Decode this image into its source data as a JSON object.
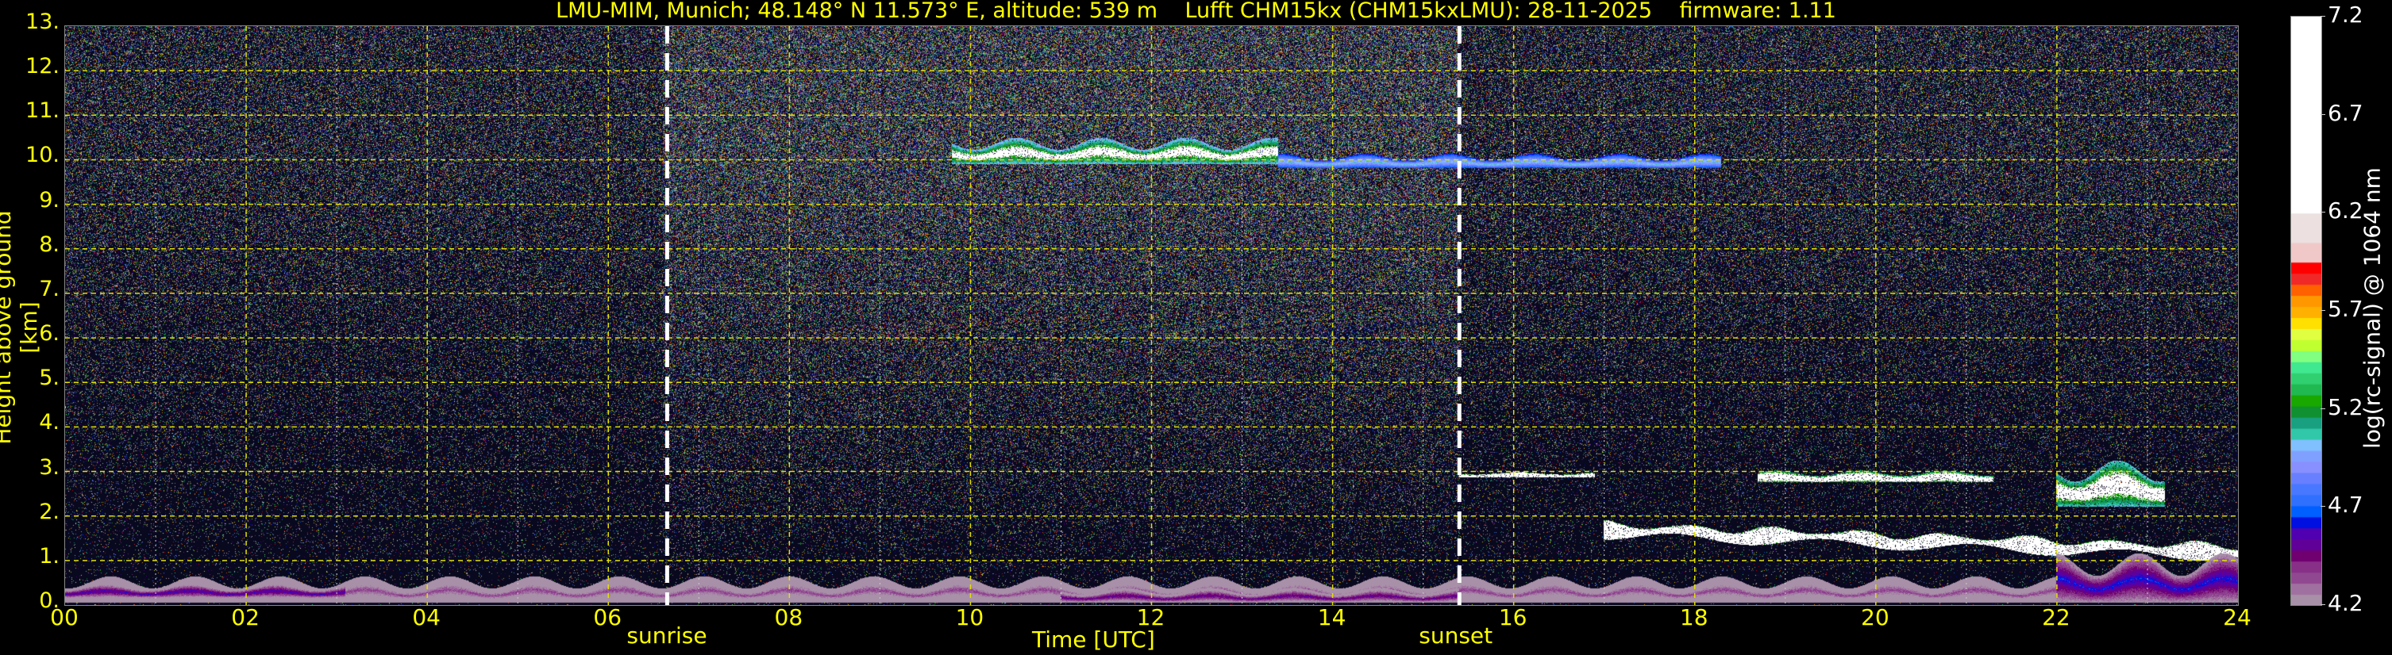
{
  "chart_data": {
    "type": "heatmap",
    "title": "LMU-MIM, Munich; 48.148° N 11.573° E, altitude: 539 m    Lufft CHM15kx (CHM15kxLMU): 28-11-2025    firmware: 1.11",
    "xlabel": "Time [UTC]",
    "ylabel": "Height above ground [km]",
    "xlim": [
      0,
      24
    ],
    "ylim": [
      0,
      13
    ],
    "x_ticks": [
      "00",
      "02",
      "04",
      "06",
      "08",
      "10",
      "12",
      "14",
      "16",
      "18",
      "20",
      "22",
      "24"
    ],
    "y_ticks": [
      "0.",
      "1.",
      "2.",
      "3.",
      "4.",
      "5.",
      "6.",
      "7.",
      "8.",
      "9.",
      "10.",
      "11.",
      "12.",
      "13."
    ],
    "grid": true,
    "events": [
      {
        "label": "sunrise",
        "hour": 6.65
      },
      {
        "label": "sunset",
        "hour": 15.4
      }
    ],
    "colorbar": {
      "label": "log(rc-signal) @ 1064 nm",
      "range": [
        4.2,
        7.2
      ],
      "ticks": [
        "4.2",
        "4.7",
        "5.2",
        "5.7",
        "6.2",
        "6.7",
        "7.2"
      ],
      "colors": [
        "#a890a8",
        "#a070a0",
        "#904890",
        "#883088",
        "#700070",
        "#600098",
        "#5000b0",
        "#0010e0",
        "#0060ff",
        "#3070ff",
        "#4878ff",
        "#6880ff",
        "#8890ff",
        "#80a0ff",
        "#80c0ff",
        "#30c8a8",
        "#18a080",
        "#109030",
        "#18a800",
        "#20b850",
        "#30d070",
        "#40e890",
        "#80ff80",
        "#c0ff30",
        "#e0ff40",
        "#ffe000",
        "#ffb000",
        "#ff9800",
        "#ff6000",
        "#f02828",
        "#ff0000",
        "#f0c8c8",
        "#ece0e0",
        "#ffffff"
      ]
    },
    "features": [
      {
        "name": "boundary-layer-aerosol",
        "start": 0,
        "end": 22,
        "base_km": 0.05,
        "top_km": 0.5,
        "value": 4.5
      },
      {
        "name": "night-aerosol-layer",
        "start": 0,
        "end": 3.1,
        "base_km": 0.15,
        "top_km": 0.4,
        "value": 4.9
      },
      {
        "name": "midday-aerosol",
        "start": 11,
        "end": 15.4,
        "base_km": 0.05,
        "top_km": 0.3,
        "value": 4.8
      },
      {
        "name": "cirrus",
        "start": 9.8,
        "end": 13.4,
        "base_km": 9.9,
        "top_km": 10.35,
        "value": 6.5
      },
      {
        "name": "cirrus-tail",
        "start": 13.4,
        "end": 18.3,
        "base_km": 9.8,
        "top_km": 10.05,
        "value": 5.8
      },
      {
        "name": "low-cloud-1",
        "start": 15.4,
        "end": 16.9,
        "base_km": 2.85,
        "top_km": 2.95,
        "value": 7.0
      },
      {
        "name": "stratus",
        "start": 17.0,
        "end": 24,
        "base_km": 1.1,
        "top_km": 1.75,
        "value": 7.0
      },
      {
        "name": "low-cloud-2",
        "start": 18.7,
        "end": 21.3,
        "base_km": 2.75,
        "top_km": 2.95,
        "value": 6.8
      },
      {
        "name": "low-cloud-3",
        "start": 22.0,
        "end": 23.2,
        "base_km": 2.2,
        "top_km": 3.0,
        "value": 6.6
      },
      {
        "name": "evening-boundary-layer",
        "start": 22.0,
        "end": 24,
        "base_km": 0.05,
        "top_km": 0.9,
        "value": 5.0
      }
    ]
  }
}
